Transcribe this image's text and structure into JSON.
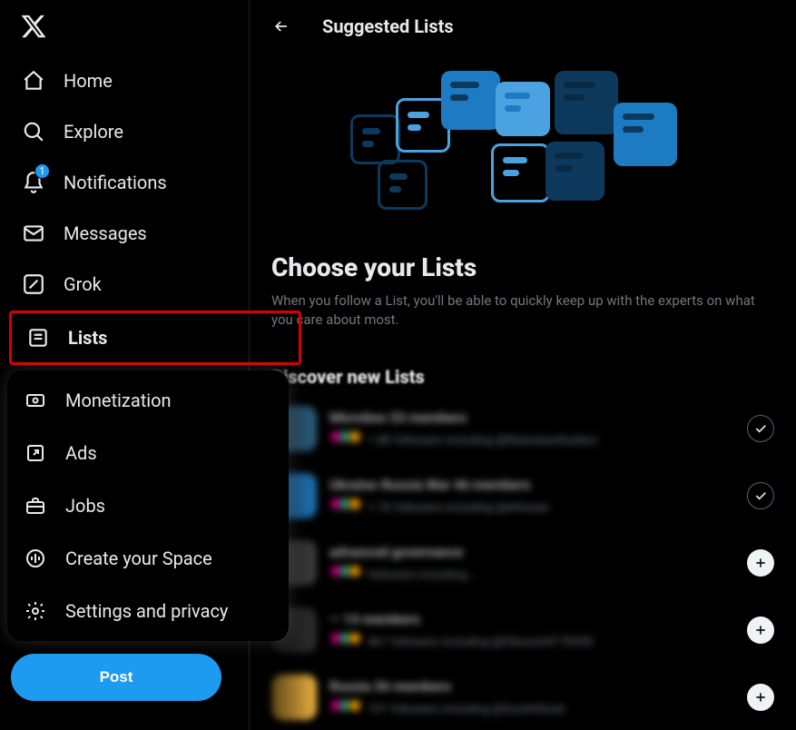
{
  "header": {
    "title": "Suggested Lists"
  },
  "sidebar": {
    "nav": [
      {
        "id": "home",
        "label": "Home"
      },
      {
        "id": "explore",
        "label": "Explore"
      },
      {
        "id": "notifications",
        "label": "Notifications",
        "badge": "1"
      },
      {
        "id": "messages",
        "label": "Messages"
      },
      {
        "id": "grok",
        "label": "Grok"
      },
      {
        "id": "lists",
        "label": "Lists",
        "highlighted": true
      }
    ],
    "more": [
      {
        "id": "monetization",
        "label": "Monetization"
      },
      {
        "id": "ads",
        "label": "Ads"
      },
      {
        "id": "jobs",
        "label": "Jobs"
      },
      {
        "id": "create-space",
        "label": "Create your Space"
      },
      {
        "id": "settings",
        "label": "Settings and privacy"
      }
    ],
    "post_label": "Post"
  },
  "choose": {
    "heading": "Choose your Lists",
    "body": "When you follow a List, you'll be able to quickly keep up with the experts on what you care about most."
  },
  "discover": {
    "heading": "Discover new Lists",
    "lists": [
      {
        "title_blur": "Microbes",
        "members_blur": "53 members",
        "sub_blur": "1.8K followers including @RadoslawSzafarz",
        "action": "check",
        "avatar_color": "#2b5a77"
      },
      {
        "title_blur": "Ukraine-Russia War",
        "members_blur": "46 members",
        "sub_blur": "1.1K followers including @ethosen",
        "action": "check",
        "avatar_color": "#1f6fae"
      },
      {
        "title_blur": "advanced governance",
        "members_blur": "",
        "sub_blur": "followers including …",
        "action": "plus",
        "avatar_color": "#3a3a3a"
      },
      {
        "title_blur": "—",
        "members_blur": "14 members",
        "sub_blur": "461 followers including @Gibson64178350",
        "action": "plus",
        "avatar_color": "#2b2b2b"
      },
      {
        "title_blur": "Russia",
        "members_blur": "36 members",
        "sub_blur": "101 followers including @ScottASorel",
        "action": "plus",
        "avatar_color": "#e0a83b"
      }
    ]
  }
}
